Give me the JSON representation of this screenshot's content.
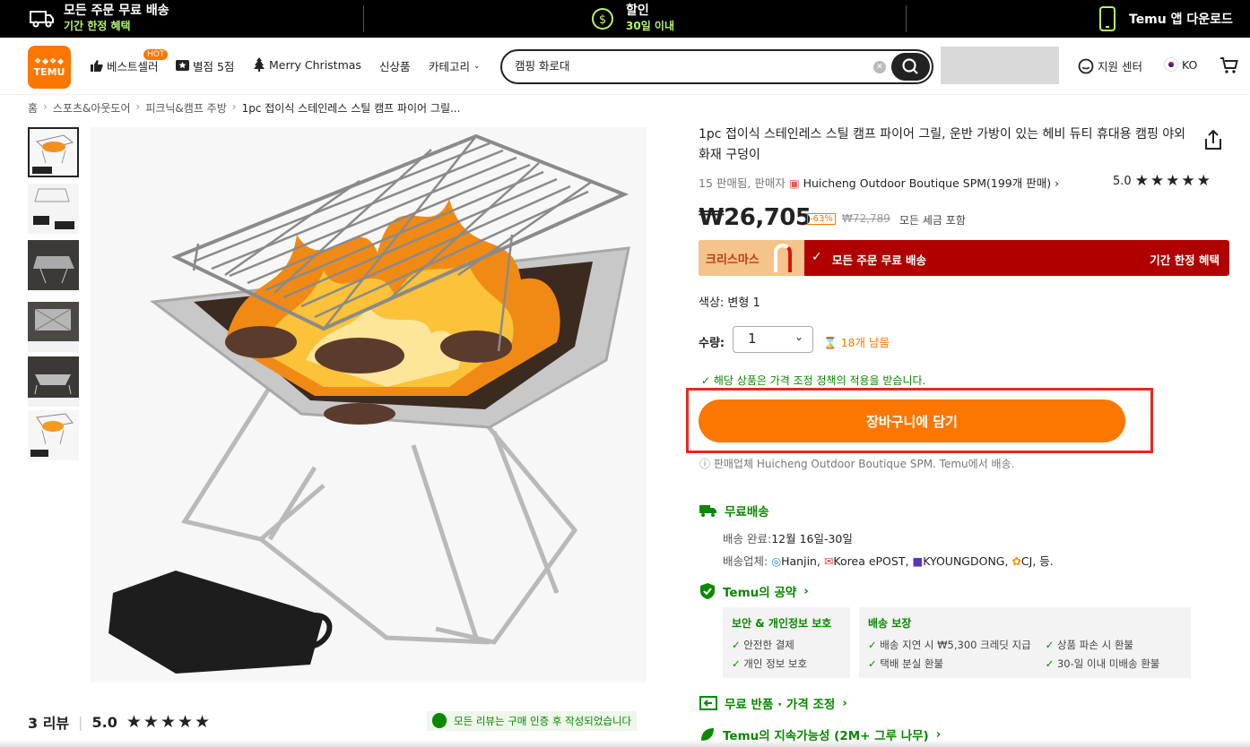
{
  "promo": {
    "free_shipping_line1": "모든 주문 무료 배송",
    "free_shipping_line2": "기간 한정 혜택",
    "sale_line1": "할인",
    "sale_line2": "30일 이내",
    "app_download": "Temu 앱 다운로드"
  },
  "header": {
    "logo_text": "TEMU",
    "nav": {
      "bestseller": "베스트셀러",
      "hot": "HOT",
      "five_star": "별점 5점",
      "christmas": "Merry Christmas",
      "new": "신상품",
      "category": "카테고리"
    },
    "search_value": "캠핑 화로대",
    "support": "지원 센터",
    "language": "KO"
  },
  "breadcrumb": [
    "홈",
    "스포츠&아웃도어",
    "피크닉&캠프 주방",
    "1pc 접이식 스테인레스 스틸 캠프 파이어 그릴..."
  ],
  "product": {
    "title": "1pc 접이식 스테인레스 스틸 캠프 파이어 그릴, 운반 가방이 있는 헤비 듀티 휴대용 캠핑 야외 화재 구덩이",
    "sold_prefix": "15 판매됨, 판매자",
    "seller_name": "Huicheng Outdoor Boutique SPM(199개 판매)",
    "rating": "5.0",
    "price": "₩26,705",
    "discount": "-63%",
    "original_price": "₩72,789",
    "tax_note": "모든 세금 포함",
    "banner_left": "크리스마스",
    "banner_center": "모든 주문 무료 배송",
    "banner_right": "기간 한정 혜택",
    "color_label": "색상: 변형 1",
    "qty_label": "수량:",
    "qty_value": "1",
    "stock": "18개 남음",
    "policy": "해당 상품은 가격 조정 정책의 적용을 받습니다.",
    "cart_button": "장바구니에 담기",
    "seller_info": "판매업체 Huicheng Outdoor Boutique SPM. Temu에서 배송."
  },
  "shipping": {
    "title": "무료배송",
    "delivery_label": "배송 완료:",
    "delivery_value": "12월 16일-30일",
    "carriers_label": "배송업체:",
    "carriers": [
      "Hanjin,",
      "Korea ePOST,",
      "KYOUNGDONG,",
      "CJ, 등."
    ]
  },
  "promise": {
    "title": "Temu의 공약",
    "security_title": "보안 & 개인정보 보호",
    "security_items": [
      "안전한 결제",
      "개인 정보 보호"
    ],
    "delivery_title": "배송 보장",
    "delivery_items": [
      "배송 지연 시 ₩5,300 크레딧 지급",
      "택배 분실 환불"
    ],
    "delivery_items_right": [
      "상품 파손 시 환불",
      "30-일 이내 미배송 환불"
    ]
  },
  "returns_title": "무료 반품 · 가격 조정",
  "sustain_title": "Temu의 지속가능성 (2M+ 그루 나무)",
  "reviews": {
    "count": "3 리뷰",
    "score": "5.0",
    "stars": "★★★★★",
    "note": "모든 리뷰는 구매 인증 후 작성되었습니다"
  },
  "colors": {
    "accent": "#fb7701",
    "green": "#0a8800",
    "banner_red": "#b10000"
  }
}
